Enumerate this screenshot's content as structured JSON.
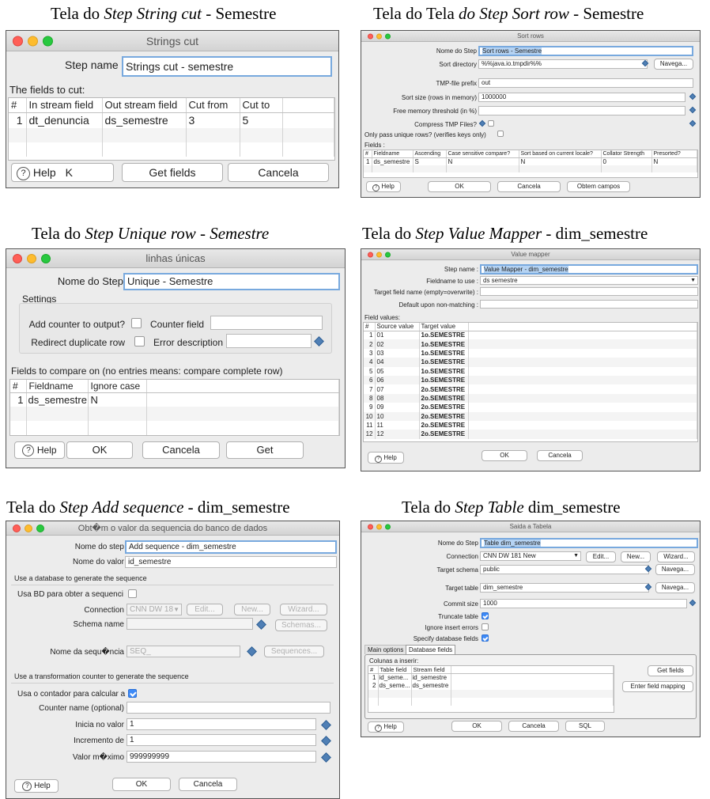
{
  "captions": {
    "c1": {
      "pre": "Tela do ",
      "it": "Step String cut",
      "post": " - Semestre"
    },
    "c2": {
      "pre": "Tela do Tela ",
      "it": "do Step Sort row",
      "post": " - Semestre"
    },
    "c3": {
      "pre": "Tela do ",
      "it": "Step Unique row - Semestre",
      "post": ""
    },
    "c4": {
      "pre": "Tela do ",
      "it": "Step Value Mapper",
      "post": " - dim_semestre"
    },
    "c5": {
      "pre": "Tela do ",
      "it": "Step Add sequence",
      "post": " - dim_semestre"
    },
    "c6": {
      "pre": "Tela do ",
      "it": "Step Table",
      "post": " dim_semestre"
    }
  },
  "strings_cut": {
    "title": "Strings cut",
    "step_name_label": "Step name",
    "step_name_value": "Strings cut - semestre",
    "fields_label": "The fields to cut:",
    "columns": [
      "#",
      "In stream field",
      "Out stream field",
      "Cut from",
      "Cut to"
    ],
    "rows": [
      [
        "1",
        "dt_denuncia",
        "ds_semestre",
        "3",
        "5"
      ]
    ],
    "help": "Help",
    "ok_fragment": "K",
    "get_fields": "Get fields",
    "cancel": "Cancela"
  },
  "sort_rows": {
    "title": "Sort rows",
    "step_name_label": "Nome do Step",
    "step_name_value": "Sort rows - Semestre",
    "sort_dir_label": "Sort directory",
    "sort_dir_value": "%%java.io.tmpdir%%",
    "browse": "Navega...",
    "tmp_prefix_label": "TMP-file prefix",
    "tmp_prefix_value": "out",
    "sort_size_label": "Sort size (rows in memory)",
    "sort_size_value": "1000000",
    "free_mem_label": "Free memory threshold (in %)",
    "compress_label": "Compress TMP Files?",
    "unique_label": "Only pass unique rows? (verifies keys only)",
    "fields_label": "Fields :",
    "columns": [
      "#",
      "Fieldname",
      "Ascending",
      "Case sensitive compare?",
      "Sort based on current locale?",
      "Collator Strength",
      "Presorted?"
    ],
    "rows": [
      [
        "1",
        "ds_semestre",
        "S",
        "N",
        "N",
        "0",
        "N"
      ]
    ],
    "help": "Help",
    "ok": "OK",
    "cancel": "Cancela",
    "get_fields": "Obtem campos"
  },
  "unique_rows": {
    "title": "linhas únicas",
    "step_name_label": "Nome do Step",
    "step_name_value": "Unique - Semestre",
    "settings_label": "Settings",
    "add_counter_label": "Add counter to output?",
    "counter_field_label": "Counter field",
    "redirect_label": "Redirect duplicate row",
    "error_desc_label": "Error description",
    "fields_label": "Fields to compare on (no entries means: compare complete row)",
    "columns": [
      "#",
      "Fieldname",
      "Ignore case"
    ],
    "rows": [
      [
        "1",
        "ds_semestre",
        "N"
      ]
    ],
    "help": "Help",
    "ok": "OK",
    "cancel": "Cancela",
    "get": "Get"
  },
  "value_mapper": {
    "title": "Value mapper",
    "step_name_label": "Step name :",
    "step_name_value": "Value Mapper - dim_semestre",
    "fieldname_label": "Fieldname to use :",
    "fieldname_value": "ds semestre",
    "target_label": "Target field name (empty=overwrite) :",
    "default_label": "Default upon non-matching :",
    "field_values_label": "Field values:",
    "columns": [
      "#",
      "Source value",
      "Target value"
    ],
    "rows": [
      [
        "1",
        "01",
        "1o.SEMESTRE"
      ],
      [
        "2",
        "02",
        "1o.SEMESTRE"
      ],
      [
        "3",
        "03",
        "1o.SEMESTRE"
      ],
      [
        "4",
        "04",
        "1o.SEMESTRE"
      ],
      [
        "5",
        "05",
        "1o.SEMESTRE"
      ],
      [
        "6",
        "06",
        "1o.SEMESTRE"
      ],
      [
        "7",
        "07",
        "2o.SEMESTRE"
      ],
      [
        "8",
        "08",
        "2o.SEMESTRE"
      ],
      [
        "9",
        "09",
        "2o.SEMESTRE"
      ],
      [
        "10",
        "10",
        "2o.SEMESTRE"
      ],
      [
        "11",
        "11",
        "2o.SEMESTRE"
      ],
      [
        "12",
        "12",
        "2o.SEMESTRE"
      ]
    ],
    "help": "Help",
    "ok": "OK",
    "cancel": "Cancela"
  },
  "add_sequence": {
    "title": "Obt�m o valor da sequencia do banco de dados",
    "step_name_label": "Nome do step",
    "step_name_value": "Add sequence - dim_semestre",
    "value_name_label": "Nome do valor",
    "value_name_value": "id_semestre",
    "db_section": "Use a database to generate the sequence",
    "use_db_label": "Usa BD para obter a sequencia",
    "connection_label": "Connection",
    "connection_value": "CNN DW 18",
    "edit": "Edit...",
    "new": "New...",
    "wizard": "Wizard...",
    "schema_label": "Schema name",
    "schemas": "Schemas...",
    "seq_name_label": "Nome da sequ�ncia",
    "seq_name_value": "SEQ_",
    "sequences": "Sequences...",
    "counter_section": "Use a transformation counter to generate the sequence",
    "use_counter_label": "Usa o contador para calcular a",
    "counter_name_label": "Counter name (optional)",
    "start_label": "Inicia no valor",
    "start_value": "1",
    "increment_label": "Incremento de",
    "increment_value": "1",
    "max_label": "Valor m�ximo",
    "max_value": "999999999",
    "help": "Help",
    "ok": "OK",
    "cancel": "Cancela"
  },
  "table_output": {
    "title": "Saida a Tabela",
    "step_name_label": "Nome do Step",
    "step_name_value": "Table dim_semestre",
    "connection_label": "Connection",
    "connection_value": "CNN DW 181 New",
    "edit": "Edit...",
    "new": "New...",
    "wizard": "Wizard...",
    "schema_label": "Target schema",
    "schema_value": "public",
    "browse": "Navega...",
    "table_label": "Target table",
    "table_value": "dim_semestre",
    "commit_label": "Commit size",
    "commit_value": "1000",
    "truncate_label": "Truncate table",
    "ignore_label": "Ignore insert errors",
    "specify_label": "Specify database fields",
    "tabs": [
      "Main options",
      "Database fields"
    ],
    "columns_label": "Colunas a inserir:",
    "columns": [
      "#",
      "Table field",
      "Stream field"
    ],
    "rows": [
      [
        "1",
        "id_seme...",
        "id_semestre"
      ],
      [
        "2",
        "ds_seme...",
        "ds_semestre"
      ]
    ],
    "get_fields": "Get fields",
    "enter_mapping": "Enter field mapping",
    "help": "Help",
    "ok": "OK",
    "cancel": "Cancela",
    "sql": "SQL"
  }
}
